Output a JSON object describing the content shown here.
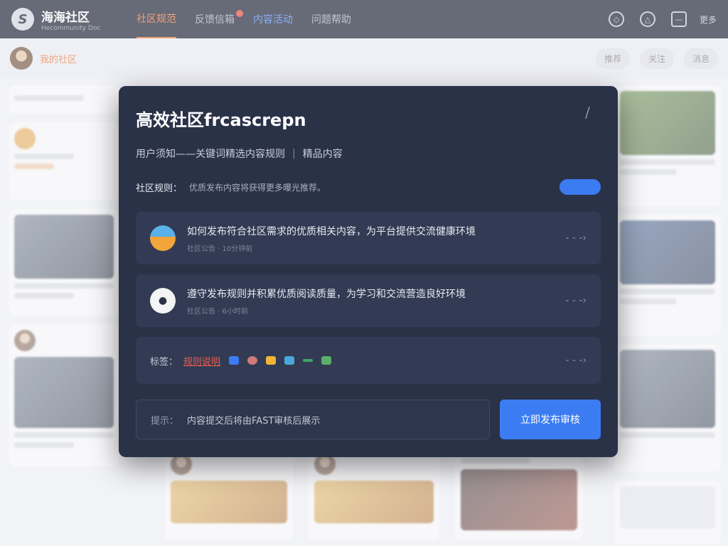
{
  "header": {
    "logo_mark": "S",
    "logo_title": "海海社区",
    "logo_sub": "Hecommunity Doc",
    "tabs": [
      {
        "label": "社区规范",
        "active": true
      },
      {
        "label": "反馈信箱"
      },
      {
        "label": "内容活动",
        "accent": true
      },
      {
        "label": "问题帮助"
      }
    ],
    "more_label": "更多"
  },
  "subbar": {
    "username": "我的社区",
    "actions": [
      "推荐",
      "关注",
      "消息"
    ]
  },
  "modal": {
    "title": "高效社区frcascrepn",
    "subtitle_left": "用户须知——关键词精选内容规则",
    "subtitle_sep": "|",
    "subtitle_right": "精品内容",
    "rule_label": "社区规则：",
    "rule_text": "优质发布内容将获得更多曝光推荐。",
    "items": [
      {
        "title": "如何发布符合社区需求的优质相关内容，为平台提供交流健康环境",
        "meta": "社区公告 · 10分钟前"
      },
      {
        "title": "遵守发布规则并积累优质阅读质量，为学习和交流营造良好环境",
        "meta": "社区公告 · 6小时前"
      }
    ],
    "tag_label": "标签：",
    "tag_value": "规则说明",
    "input_label": "提示：",
    "input_text": "内容提交后将由FAST审核后展示",
    "submit_label": "立即发布审核"
  },
  "colors": {
    "header_bg": "#1e2333",
    "accent_orange": "#f07a3a",
    "accent_blue": "#3c7cf2",
    "modal_bg": "#2a3248"
  },
  "icons": {
    "modal_close": "close-icon",
    "item_arrow": "arrow-right-icon"
  }
}
